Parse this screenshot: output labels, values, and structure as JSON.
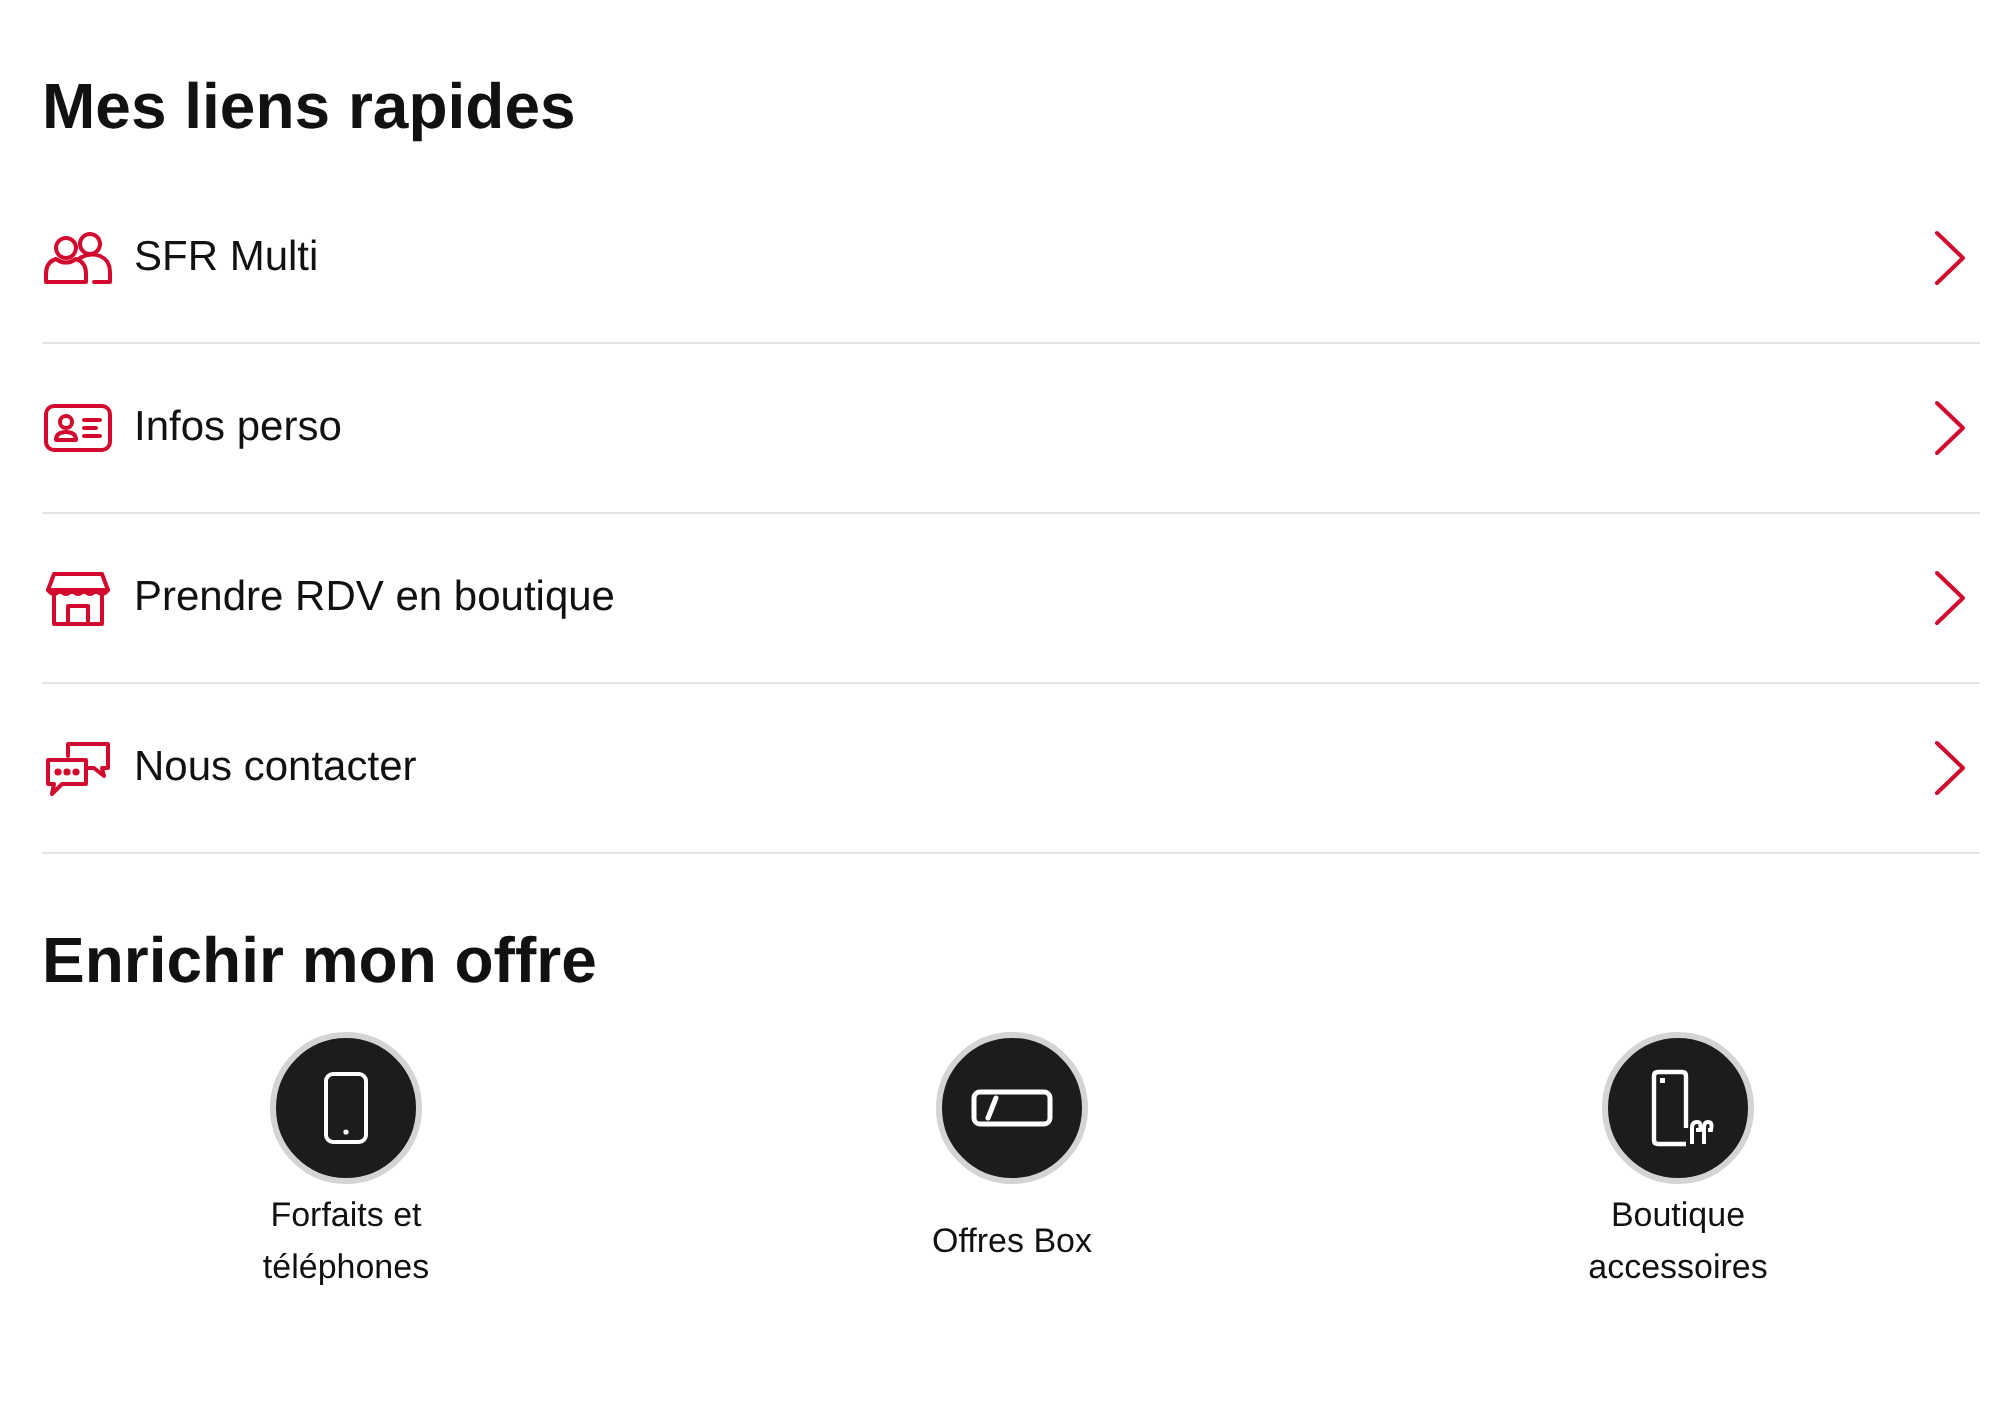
{
  "quick_links": {
    "title": "Mes liens rapides",
    "items": [
      {
        "label": "SFR Multi"
      },
      {
        "label": "Infos perso"
      },
      {
        "label": "Prendre RDV en boutique"
      },
      {
        "label": "Nous contacter"
      }
    ]
  },
  "enrich_offer": {
    "title": "Enrichir mon offre",
    "items": [
      {
        "label": "Forfaits et téléphones"
      },
      {
        "label": "Offres Box"
      },
      {
        "label": "Boutique accessoires"
      }
    ]
  }
}
